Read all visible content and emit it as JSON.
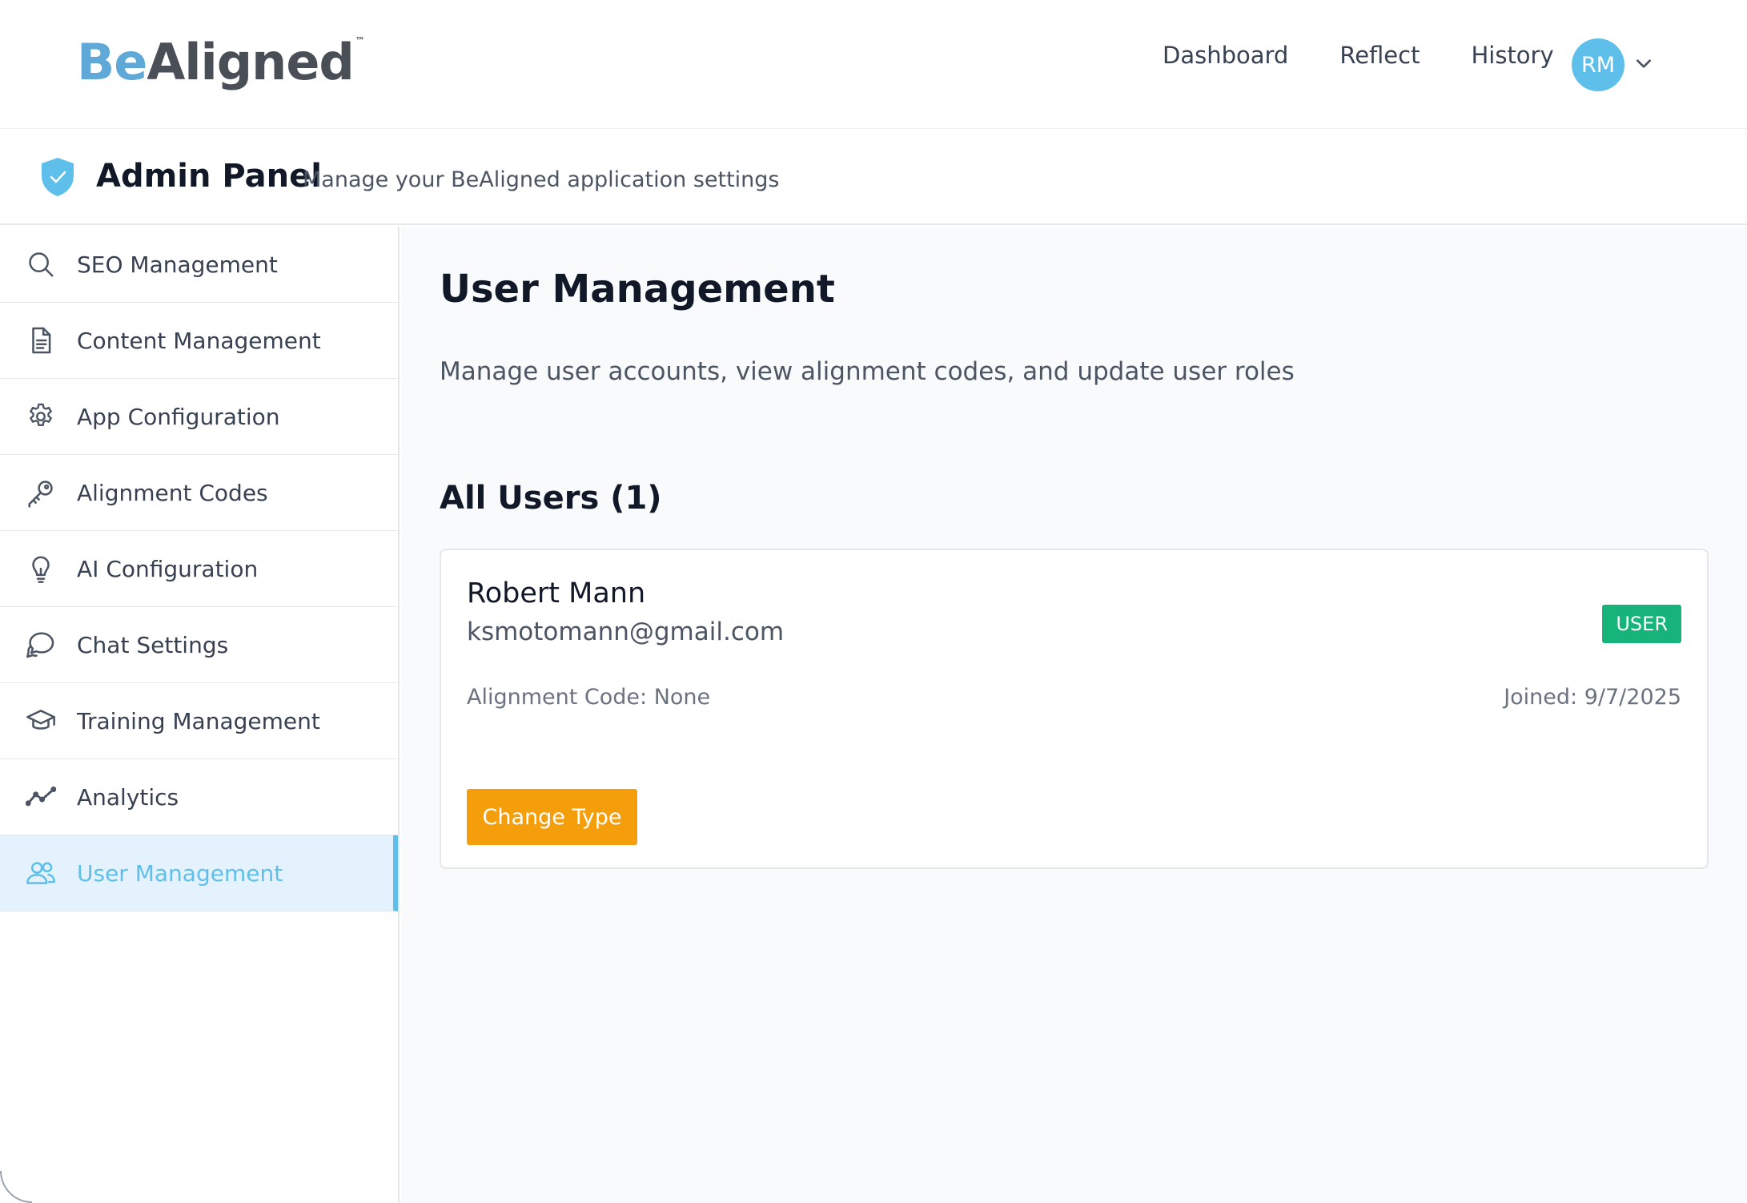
{
  "brand": {
    "logo_part1": "Be",
    "logo_part2": "Aligned",
    "trademark": "™",
    "primary_color": "#5ec0ea",
    "logo_blue": "#5fa9d8",
    "logo_gray": "#4a4f57"
  },
  "nav": {
    "links": [
      "Dashboard",
      "Reflect",
      "History"
    ],
    "avatar_initials": "RM",
    "avatar_menu_icon": "chevron-down-icon"
  },
  "admin_header": {
    "icon": "shield-check-icon",
    "title": "Admin Panel",
    "subtitle": "Manage your BeAligned application settings"
  },
  "sidebar": {
    "items": [
      {
        "label": "SEO Management",
        "icon": "search-icon",
        "active": false
      },
      {
        "label": "Content Management",
        "icon": "document-icon",
        "active": false
      },
      {
        "label": "App Configuration",
        "icon": "gear-icon",
        "active": false
      },
      {
        "label": "Alignment Codes",
        "icon": "key-icon",
        "active": false
      },
      {
        "label": "AI Configuration",
        "icon": "lightbulb-icon",
        "active": false
      },
      {
        "label": "Chat Settings",
        "icon": "chat-bubbles-icon",
        "active": false
      },
      {
        "label": "Training Management",
        "icon": "graduation-cap-icon",
        "active": false
      },
      {
        "label": "Analytics",
        "icon": "trend-line-icon",
        "active": false
      },
      {
        "label": "User Management",
        "icon": "users-icon",
        "active": true
      }
    ]
  },
  "main": {
    "title": "User Management",
    "description": "Manage user accounts, view alignment codes, and update user roles",
    "users_heading": "All Users (1)",
    "users": [
      {
        "name": "Robert Mann",
        "email": "ksmotomann@gmail.com",
        "role": "USER",
        "role_color": "#16b37a",
        "alignment_code": "Alignment Code: None",
        "joined": "Joined: 9/7/2025",
        "action_label": "Change Type",
        "action_color": "#f59e0b"
      }
    ]
  }
}
